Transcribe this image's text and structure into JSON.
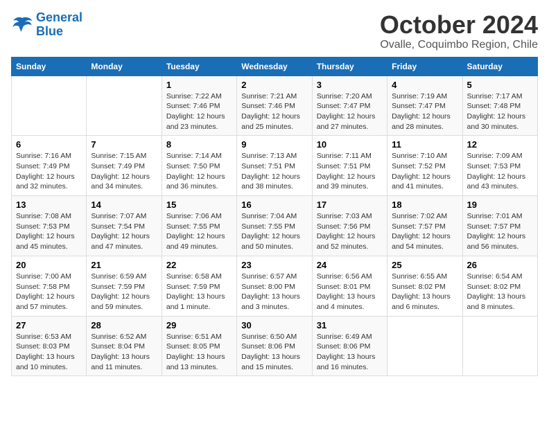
{
  "logo": {
    "line1": "General",
    "line2": "Blue"
  },
  "title": "October 2024",
  "subtitle": "Ovalle, Coquimbo Region, Chile",
  "days_of_week": [
    "Sunday",
    "Monday",
    "Tuesday",
    "Wednesday",
    "Thursday",
    "Friday",
    "Saturday"
  ],
  "weeks": [
    [
      {
        "num": "",
        "info": ""
      },
      {
        "num": "",
        "info": ""
      },
      {
        "num": "1",
        "info": "Sunrise: 7:22 AM\nSunset: 7:46 PM\nDaylight: 12 hours\nand 23 minutes."
      },
      {
        "num": "2",
        "info": "Sunrise: 7:21 AM\nSunset: 7:46 PM\nDaylight: 12 hours\nand 25 minutes."
      },
      {
        "num": "3",
        "info": "Sunrise: 7:20 AM\nSunset: 7:47 PM\nDaylight: 12 hours\nand 27 minutes."
      },
      {
        "num": "4",
        "info": "Sunrise: 7:19 AM\nSunset: 7:47 PM\nDaylight: 12 hours\nand 28 minutes."
      },
      {
        "num": "5",
        "info": "Sunrise: 7:17 AM\nSunset: 7:48 PM\nDaylight: 12 hours\nand 30 minutes."
      }
    ],
    [
      {
        "num": "6",
        "info": "Sunrise: 7:16 AM\nSunset: 7:49 PM\nDaylight: 12 hours\nand 32 minutes."
      },
      {
        "num": "7",
        "info": "Sunrise: 7:15 AM\nSunset: 7:49 PM\nDaylight: 12 hours\nand 34 minutes."
      },
      {
        "num": "8",
        "info": "Sunrise: 7:14 AM\nSunset: 7:50 PM\nDaylight: 12 hours\nand 36 minutes."
      },
      {
        "num": "9",
        "info": "Sunrise: 7:13 AM\nSunset: 7:51 PM\nDaylight: 12 hours\nand 38 minutes."
      },
      {
        "num": "10",
        "info": "Sunrise: 7:11 AM\nSunset: 7:51 PM\nDaylight: 12 hours\nand 39 minutes."
      },
      {
        "num": "11",
        "info": "Sunrise: 7:10 AM\nSunset: 7:52 PM\nDaylight: 12 hours\nand 41 minutes."
      },
      {
        "num": "12",
        "info": "Sunrise: 7:09 AM\nSunset: 7:53 PM\nDaylight: 12 hours\nand 43 minutes."
      }
    ],
    [
      {
        "num": "13",
        "info": "Sunrise: 7:08 AM\nSunset: 7:53 PM\nDaylight: 12 hours\nand 45 minutes."
      },
      {
        "num": "14",
        "info": "Sunrise: 7:07 AM\nSunset: 7:54 PM\nDaylight: 12 hours\nand 47 minutes."
      },
      {
        "num": "15",
        "info": "Sunrise: 7:06 AM\nSunset: 7:55 PM\nDaylight: 12 hours\nand 49 minutes."
      },
      {
        "num": "16",
        "info": "Sunrise: 7:04 AM\nSunset: 7:55 PM\nDaylight: 12 hours\nand 50 minutes."
      },
      {
        "num": "17",
        "info": "Sunrise: 7:03 AM\nSunset: 7:56 PM\nDaylight: 12 hours\nand 52 minutes."
      },
      {
        "num": "18",
        "info": "Sunrise: 7:02 AM\nSunset: 7:57 PM\nDaylight: 12 hours\nand 54 minutes."
      },
      {
        "num": "19",
        "info": "Sunrise: 7:01 AM\nSunset: 7:57 PM\nDaylight: 12 hours\nand 56 minutes."
      }
    ],
    [
      {
        "num": "20",
        "info": "Sunrise: 7:00 AM\nSunset: 7:58 PM\nDaylight: 12 hours\nand 57 minutes."
      },
      {
        "num": "21",
        "info": "Sunrise: 6:59 AM\nSunset: 7:59 PM\nDaylight: 12 hours\nand 59 minutes."
      },
      {
        "num": "22",
        "info": "Sunrise: 6:58 AM\nSunset: 7:59 PM\nDaylight: 13 hours\nand 1 minute."
      },
      {
        "num": "23",
        "info": "Sunrise: 6:57 AM\nSunset: 8:00 PM\nDaylight: 13 hours\nand 3 minutes."
      },
      {
        "num": "24",
        "info": "Sunrise: 6:56 AM\nSunset: 8:01 PM\nDaylight: 13 hours\nand 4 minutes."
      },
      {
        "num": "25",
        "info": "Sunrise: 6:55 AM\nSunset: 8:02 PM\nDaylight: 13 hours\nand 6 minutes."
      },
      {
        "num": "26",
        "info": "Sunrise: 6:54 AM\nSunset: 8:02 PM\nDaylight: 13 hours\nand 8 minutes."
      }
    ],
    [
      {
        "num": "27",
        "info": "Sunrise: 6:53 AM\nSunset: 8:03 PM\nDaylight: 13 hours\nand 10 minutes."
      },
      {
        "num": "28",
        "info": "Sunrise: 6:52 AM\nSunset: 8:04 PM\nDaylight: 13 hours\nand 11 minutes."
      },
      {
        "num": "29",
        "info": "Sunrise: 6:51 AM\nSunset: 8:05 PM\nDaylight: 13 hours\nand 13 minutes."
      },
      {
        "num": "30",
        "info": "Sunrise: 6:50 AM\nSunset: 8:06 PM\nDaylight: 13 hours\nand 15 minutes."
      },
      {
        "num": "31",
        "info": "Sunrise: 6:49 AM\nSunset: 8:06 PM\nDaylight: 13 hours\nand 16 minutes."
      },
      {
        "num": "",
        "info": ""
      },
      {
        "num": "",
        "info": ""
      }
    ]
  ]
}
